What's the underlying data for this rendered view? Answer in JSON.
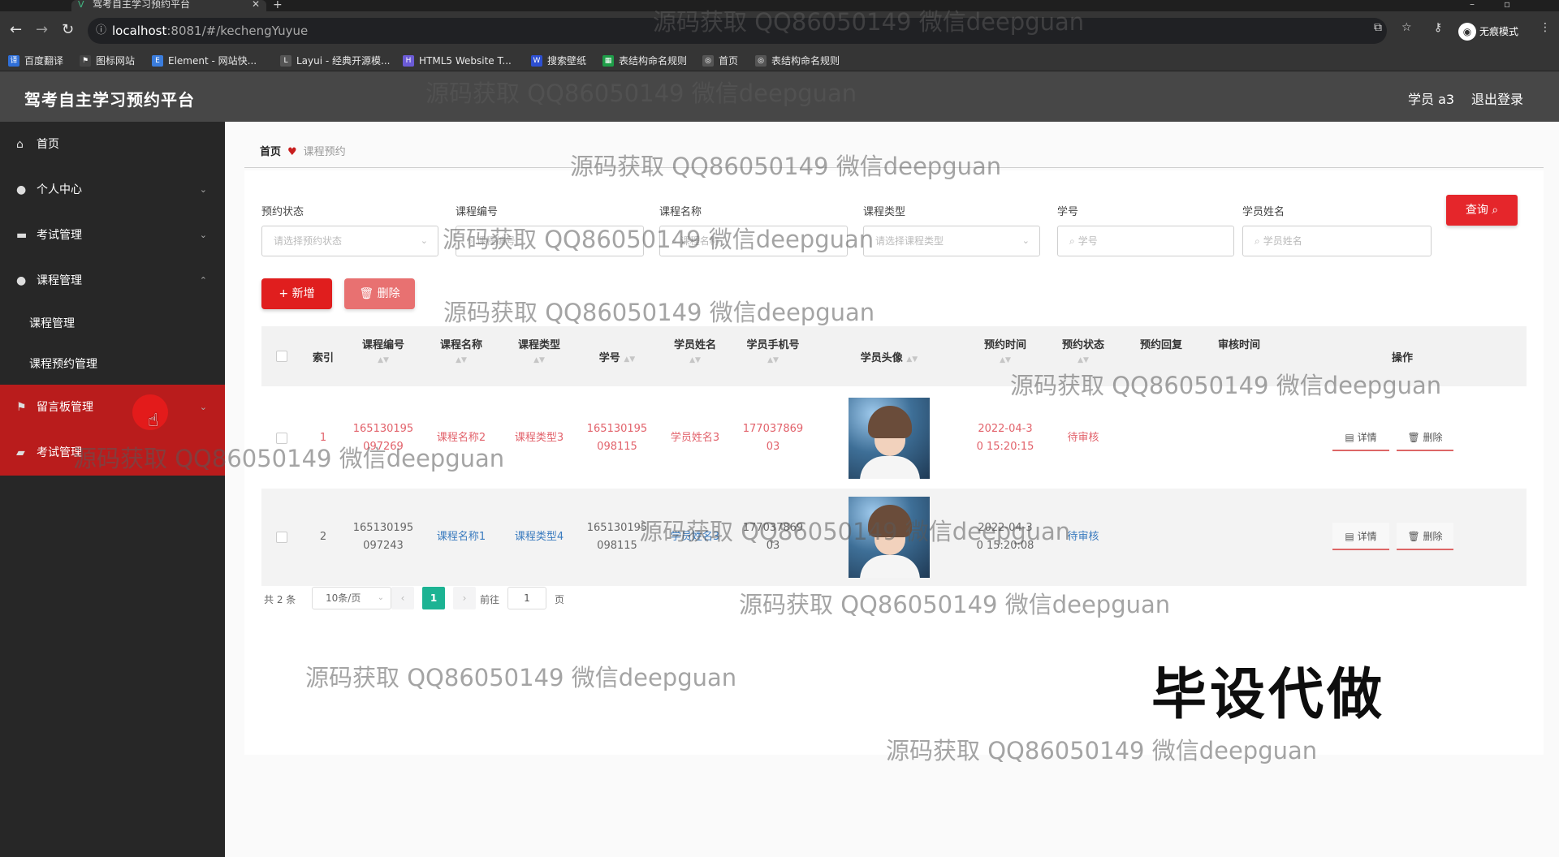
{
  "browser": {
    "tab_title": "驾考自主学习预约平台",
    "url_host": "localhost",
    "url_path": ":8081/#/kechengYuyue",
    "incognito_label": "无痕模式",
    "bookmarks": [
      "百度翻译",
      "图标网站",
      "Element - 网站快...",
      "Layui - 经典开源模...",
      "HTML5 Website T...",
      "搜索壁纸",
      "表结构命名规则",
      "首页",
      "表结构命名规则"
    ]
  },
  "header": {
    "title": "驾考自主学习预约平台",
    "user": "学员 a3",
    "logout": "退出登录"
  },
  "sidebar": {
    "items": [
      {
        "label": "首页"
      },
      {
        "label": "个人中心"
      },
      {
        "label": "考试管理"
      },
      {
        "label": "课程管理"
      },
      {
        "label": "课程管理"
      },
      {
        "label": "课程预约管理"
      },
      {
        "label": "留言板管理"
      },
      {
        "label": "考试管理"
      }
    ]
  },
  "breadcrumb": {
    "home": "首页",
    "current": "课程预约"
  },
  "filters": {
    "status": {
      "label": "预约状态",
      "placeholder": "请选择预约状态"
    },
    "course_no": {
      "label": "课程编号",
      "placeholder": "课程编号"
    },
    "course_name": {
      "label": "课程名称",
      "placeholder": "课程名称"
    },
    "course_type": {
      "label": "课程类型",
      "placeholder": "请选择课程类型"
    },
    "student_no": {
      "label": "学号",
      "placeholder": "学号"
    },
    "student_name": {
      "label": "学员姓名",
      "placeholder": "学员姓名"
    },
    "query_label": "查询"
  },
  "toolbar": {
    "add_label": "新增",
    "delete_label": "删除"
  },
  "table": {
    "headers": {
      "index": "索引",
      "course_no": "课程编号",
      "course_name": "课程名称",
      "course_type": "课程类型",
      "student_no": "学号",
      "student_name": "学员姓名",
      "phone": "学员手机号",
      "avatar": "学员头像",
      "time": "预约时间",
      "status": "预约状态",
      "reply": "预约回复",
      "audit": "审核时间",
      "ops": "操作"
    },
    "rows": [
      {
        "index": "1",
        "course_no_1": "165130195",
        "course_no_2": "097269",
        "course_name": "课程名称2",
        "course_type": "课程类型3",
        "student_no_1": "165130195",
        "student_no_2": "098115",
        "student_name": "学员姓名3",
        "phone_1": "177037869",
        "phone_2": "03",
        "time_1": "2022-04-3",
        "time_2": "0 15:20:15",
        "status": "待审核",
        "detail": "详情",
        "delete": "删除"
      },
      {
        "index": "2",
        "course_no_1": "165130195",
        "course_no_2": "097243",
        "course_name": "课程名称1",
        "course_type": "课程类型4",
        "student_no_1": "165130195",
        "student_no_2": "098115",
        "student_name": "学员姓名3",
        "phone_1": "177037869",
        "phone_2": "03",
        "time_1": "2022-04-3",
        "time_2": "0 15:20:08",
        "status": "待审核",
        "detail": "详情",
        "delete": "删除"
      }
    ]
  },
  "pagination": {
    "total": "共 2 条",
    "page_size": "10条/页",
    "current_page": "1",
    "goto_label": "前往",
    "goto_value": "1",
    "page_suffix": "页"
  },
  "watermarks": {
    "text": "源码获取 QQ86050149 微信deepguan",
    "big": "毕设代做"
  },
  "colors": {
    "accent": "#e01e1e",
    "sidebar_bg": "#272727",
    "header_bg": "#474747",
    "page_active": "#1cb393"
  }
}
